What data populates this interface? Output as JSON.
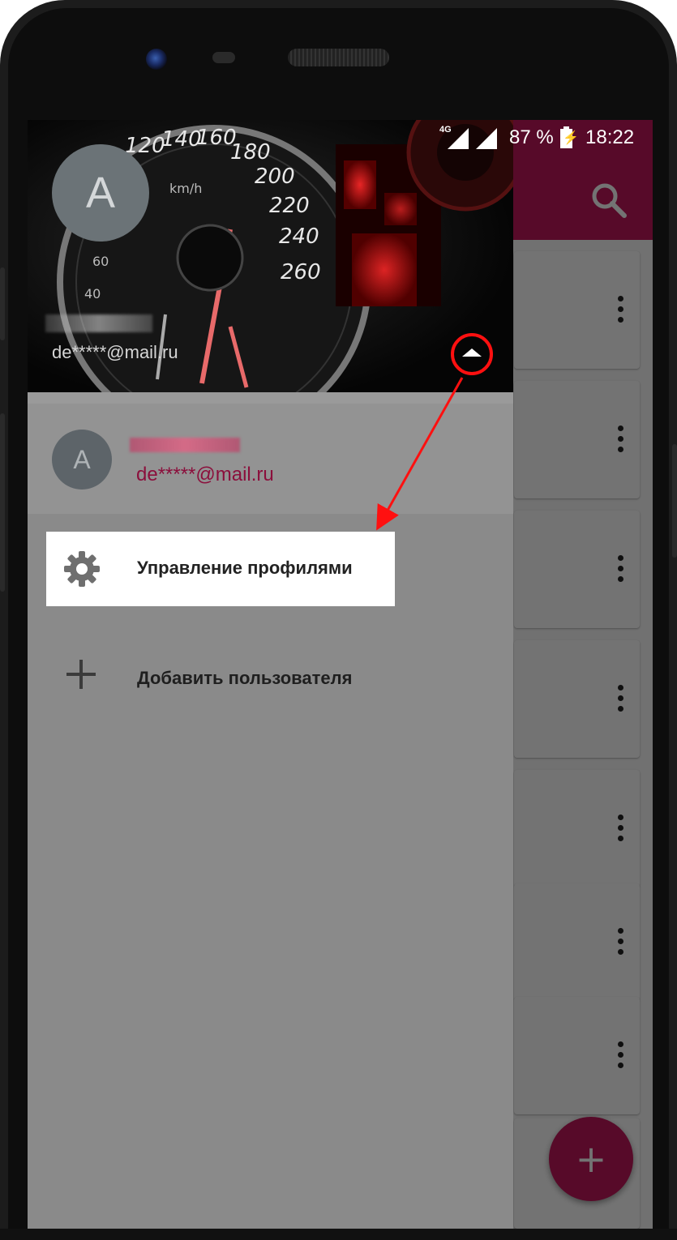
{
  "status_bar": {
    "network": "4G",
    "battery": "87 %",
    "time": "18:22"
  },
  "drawer": {
    "header": {
      "avatar_letter": "A",
      "email": "de*****@mail.ru"
    },
    "account": {
      "avatar_letter": "A",
      "email": "de*****@mail.ru"
    },
    "menu": {
      "manage_profiles": "Управление профилями",
      "add_user": "Добавить пользователя"
    }
  },
  "app": {
    "fab_label": "+"
  },
  "colors": {
    "accent": "#c2185b",
    "annotation": "#ff1010"
  },
  "icons": [
    "search-icon",
    "more-vert-icon",
    "chevron-up-icon",
    "gear-icon",
    "plus-icon",
    "battery-charging-icon",
    "signal-icon"
  ]
}
